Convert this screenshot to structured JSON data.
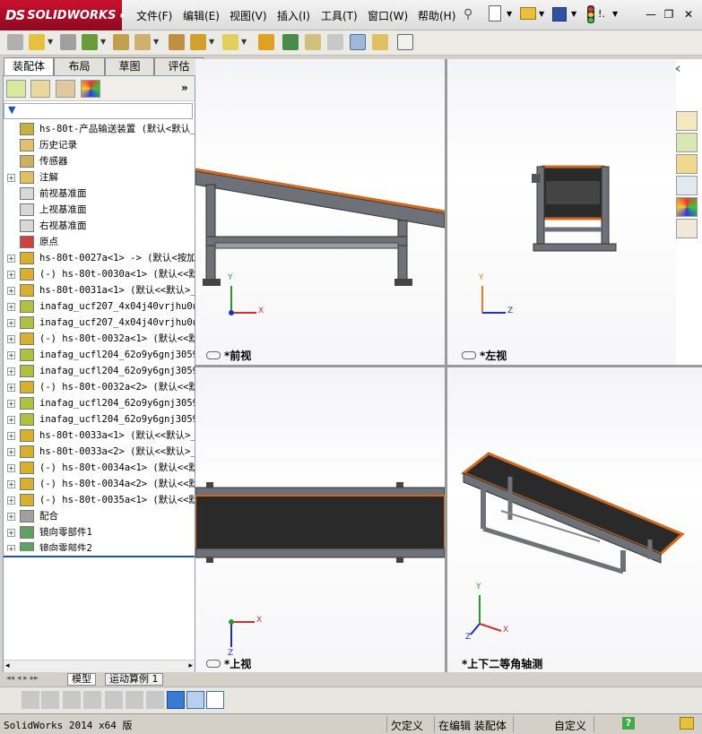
{
  "app": {
    "logo_text": "SOLIDWORKS",
    "logo_prefix": "DS"
  },
  "menu": [
    "文件(F)",
    "编辑(E)",
    "视图(V)",
    "插入(I)",
    "工具(T)",
    "窗口(W)",
    "帮助(H)"
  ],
  "window_controls": {
    "minimize": "—",
    "restore": "❐",
    "close": "✕"
  },
  "cmd_tabs": [
    "装配体",
    "布局",
    "草图",
    "评估"
  ],
  "active_cmd_tab": "装配体",
  "tree": [
    {
      "label": "hs-80t-产品输送装置  (默认<默认_",
      "expand": "",
      "icon": "assembly-icon"
    },
    {
      "label": "历史记录",
      "expand": "",
      "icon": "history-icon"
    },
    {
      "label": "传感器",
      "expand": "",
      "icon": "sensor-icon"
    },
    {
      "label": "注解",
      "expand": "+",
      "icon": "annotation-icon"
    },
    {
      "label": "前视基准面",
      "expand": "",
      "icon": "plane-icon"
    },
    {
      "label": "上视基准面",
      "expand": "",
      "icon": "plane-icon"
    },
    {
      "label": "右视基准面",
      "expand": "",
      "icon": "plane-icon"
    },
    {
      "label": "原点",
      "expand": "",
      "icon": "origin-icon"
    },
    {
      "label": "hs-80t-0027a<1> -> (默认<按加",
      "expand": "+",
      "icon": "subassembly-icon"
    },
    {
      "label": "(-) hs-80t-0030a<1> (默认<<默",
      "expand": "+",
      "icon": "subassembly-icon"
    },
    {
      "label": "hs-80t-0031a<1> (默认<<默认>_",
      "expand": "+",
      "icon": "subassembly-icon"
    },
    {
      "label": "inafag_ucf207_4x04j40vrjhu0u5",
      "expand": "+",
      "icon": "part-icon"
    },
    {
      "label": "inafag_ucf207_4x04j40vrjhu0u5",
      "expand": "+",
      "icon": "part-icon"
    },
    {
      "label": "(-) hs-80t-0032a<1> (默认<<默",
      "expand": "+",
      "icon": "subassembly-icon"
    },
    {
      "label": "inafag_ucfl204_62o9y6gnj3059x",
      "expand": "+",
      "icon": "part-icon"
    },
    {
      "label": "inafag_ucfl204_62o9y6gnj3059x",
      "expand": "+",
      "icon": "part-icon"
    },
    {
      "label": "(-) hs-80t-0032a<2> (默认<<默",
      "expand": "+",
      "icon": "subassembly-icon"
    },
    {
      "label": "inafag_ucfl204_62o9y6gnj3059x",
      "expand": "+",
      "icon": "part-icon"
    },
    {
      "label": "inafag_ucfl204_62o9y6gnj3059x",
      "expand": "+",
      "icon": "part-icon"
    },
    {
      "label": "hs-80t-0033a<1> (默认<<默认>_",
      "expand": "+",
      "icon": "subassembly-icon"
    },
    {
      "label": "hs-80t-0033a<2> (默认<<默认>_",
      "expand": "+",
      "icon": "subassembly-icon"
    },
    {
      "label": "(-) hs-80t-0034a<1> (默认<<默",
      "expand": "+",
      "icon": "subassembly-icon"
    },
    {
      "label": "(-) hs-80t-0034a<2> (默认<<默",
      "expand": "+",
      "icon": "subassembly-icon"
    },
    {
      "label": "(-) hs-80t-0035a<1> (默认<<默",
      "expand": "+",
      "icon": "subassembly-icon"
    },
    {
      "label": "配合",
      "expand": "+",
      "icon": "mates-icon"
    },
    {
      "label": "镜向零部件1",
      "expand": "+",
      "icon": "mirror-icon"
    },
    {
      "label": "镜向零部件2",
      "expand": "+",
      "icon": "mirror-icon"
    }
  ],
  "views": {
    "front": "*前视",
    "left": "*左视",
    "top": "*上视",
    "iso": "*上下二等角轴测"
  },
  "axes": {
    "x": "X",
    "y": "Y",
    "z": "Z"
  },
  "bottom_tabs": [
    "模型",
    "运动算例 1"
  ],
  "status": {
    "app": "SolidWorks 2014 x64 版",
    "defined": "欠定义",
    "editing": "在编辑 装配体",
    "custom": "自定义",
    "help": "?"
  },
  "colors": {
    "accent_red": "#c8102e",
    "belt_orange": "#d2691e",
    "frame_gray": "#6e7278",
    "belt_dark": "#2a2a2a"
  }
}
